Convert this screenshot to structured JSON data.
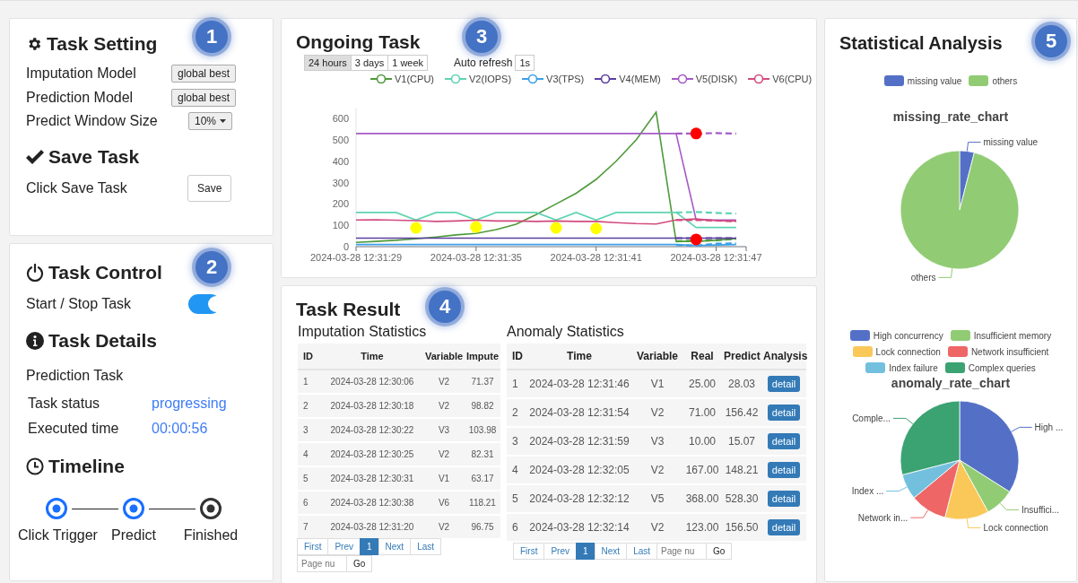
{
  "task_setting": {
    "badge": "1",
    "title": "Task Setting",
    "rows": [
      {
        "label": "Imputation Model",
        "control": "global best",
        "kind": "button"
      },
      {
        "label": "Prediction Model",
        "control": "global best",
        "kind": "button"
      },
      {
        "label": "Predict Window Size",
        "control": "10%",
        "kind": "dropdown"
      }
    ],
    "save_title": "Save Task",
    "save_label": "Click Save Task",
    "save_button": "Save"
  },
  "task_control": {
    "badge": "2",
    "title": "Task Control",
    "toggle_label": "Start / Stop Task",
    "toggle_on": true,
    "details_title": "Task Details",
    "details_subtitle": "Prediction Task",
    "details": [
      {
        "label": "Task status",
        "value": "progressing"
      },
      {
        "label": "Executed time",
        "value": "00:00:56"
      }
    ],
    "timeline_title": "Timeline",
    "timeline": [
      {
        "label": "Click Trigger",
        "done": true
      },
      {
        "label": "Predict",
        "done": true
      },
      {
        "label": "Finished",
        "done": false
      }
    ]
  },
  "ongoing_task": {
    "badge": "3",
    "title": "Ongoing Task",
    "ranges": [
      {
        "label": "24 hours",
        "selected": true
      },
      {
        "label": "3 days",
        "selected": false
      },
      {
        "label": "1 week",
        "selected": false
      }
    ],
    "auto_refresh_label": "Auto refresh",
    "auto_refresh_value": "1s",
    "chart_data": {
      "type": "line",
      "categories": [
        "2024-03-28 12:31:29",
        null,
        null,
        null,
        null,
        null,
        "2024-03-28 12:31:35",
        null,
        null,
        null,
        null,
        null,
        "2024-03-28 12:31:41",
        null,
        null,
        null,
        null,
        null,
        "2024-03-28 12:31:47",
        null
      ],
      "ylim": [
        0,
        650
      ],
      "yticks": [
        0,
        100,
        200,
        300,
        400,
        500,
        600
      ],
      "series": [
        {
          "name": "V1(CPU)",
          "color": "#4e9a3a",
          "values": [
            20,
            25,
            30,
            37,
            45,
            55,
            62,
            80,
            105,
            150,
            200,
            250,
            315,
            400,
            500,
            630,
            25,
            25,
            30,
            38
          ]
        },
        {
          "name": "V2(IOPS)",
          "color": "#5fd3b3",
          "values": [
            160,
            160,
            160,
            125,
            160,
            160,
            125,
            160,
            160,
            160,
            125,
            160,
            125,
            160,
            160,
            160,
            160,
            90,
            90,
            90
          ]
        },
        {
          "name": "V3(TPS)",
          "color": "#3ba0e8",
          "values": [
            10,
            10,
            10,
            10,
            10,
            10,
            10,
            10,
            10,
            10,
            10,
            10,
            10,
            10,
            10,
            10,
            10,
            5,
            8,
            10
          ]
        },
        {
          "name": "V4(MEM)",
          "color": "#5b3fa0",
          "values": [
            40,
            40,
            40,
            40,
            40,
            40,
            40,
            40,
            40,
            40,
            40,
            40,
            40,
            40,
            40,
            40,
            40,
            null,
            40,
            40
          ]
        },
        {
          "name": "V5(DISK)",
          "color": "#a65bc8",
          "values": [
            530,
            530,
            530,
            530,
            530,
            530,
            530,
            530,
            530,
            530,
            530,
            530,
            530,
            530,
            530,
            530,
            530,
            125,
            125,
            125
          ]
        },
        {
          "name": "V6(CPU)",
          "color": "#d14a7d",
          "values": [
            125,
            126,
            124,
            122,
            118,
            120,
            124,
            120,
            120,
            118,
            120,
            118,
            118,
            112,
            108,
            106,
            125,
            130,
            122,
            120
          ]
        },
        {
          "color": "#4e9a3a",
          "line_style": "dashed",
          "values": [
            null,
            null,
            null,
            null,
            null,
            null,
            null,
            null,
            null,
            null,
            null,
            null,
            null,
            null,
            null,
            null,
            25,
            28,
            30,
            36
          ]
        },
        {
          "color": "#5fd3b3",
          "line_style": "dashed",
          "values": [
            null,
            null,
            null,
            null,
            null,
            null,
            null,
            null,
            null,
            null,
            null,
            null,
            null,
            null,
            null,
            null,
            160,
            162,
            158,
            155
          ]
        },
        {
          "color": "#3ba0e8",
          "line_style": "dashed",
          "values": [
            null,
            null,
            null,
            null,
            null,
            null,
            null,
            null,
            null,
            null,
            null,
            null,
            null,
            null,
            null,
            null,
            8,
            5,
            14,
            15
          ]
        },
        {
          "color": "#5b3fa0",
          "line_style": "dashed",
          "values": [
            null,
            null,
            null,
            null,
            null,
            null,
            null,
            null,
            null,
            null,
            null,
            null,
            null,
            null,
            null,
            null,
            40,
            40,
            40,
            40
          ]
        },
        {
          "color": "#a65bc8",
          "line_style": "dashed",
          "values": [
            null,
            null,
            null,
            null,
            null,
            null,
            null,
            null,
            null,
            null,
            null,
            null,
            null,
            null,
            null,
            null,
            530,
            530,
            532,
            530
          ]
        },
        {
          "color": "#d14a7d",
          "line_style": "dashed",
          "values": [
            null,
            null,
            null,
            null,
            null,
            null,
            null,
            null,
            null,
            null,
            null,
            null,
            null,
            null,
            null,
            null,
            125,
            125,
            122,
            118
          ]
        },
        {
          "type": "scatter",
          "color": "#ffff00",
          "marker": "circle",
          "values": [
            null,
            null,
            null,
            88,
            null,
            null,
            92,
            null,
            null,
            null,
            88,
            null,
            85,
            null,
            null,
            null,
            null,
            null,
            null,
            null
          ]
        },
        {
          "type": "scatter",
          "color": "#ff0000",
          "marker": "circle",
          "values": [
            null,
            null,
            null,
            null,
            null,
            null,
            null,
            null,
            null,
            null,
            null,
            null,
            null,
            null,
            null,
            null,
            null,
            530,
            null,
            null
          ]
        },
        {
          "type": "scatter",
          "color": "#ff0000",
          "marker": "circle",
          "values": [
            null,
            null,
            null,
            null,
            null,
            null,
            null,
            null,
            null,
            null,
            null,
            null,
            null,
            null,
            null,
            null,
            null,
            34,
            null,
            null
          ]
        }
      ]
    }
  },
  "task_result": {
    "badge": "4",
    "title": "Task Result",
    "imputation": {
      "title": "Imputation Statistics",
      "columns": [
        "ID",
        "Time",
        "Variable",
        "Impute"
      ],
      "rows": [
        [
          "1",
          "2024-03-28 12:30:06",
          "V2",
          "71.37"
        ],
        [
          "2",
          "2024-03-28 12:30:18",
          "V2",
          "98.82"
        ],
        [
          "3",
          "2024-03-28 12:30:22",
          "V3",
          "103.98"
        ],
        [
          "4",
          "2024-03-28 12:30:25",
          "V2",
          "82.31"
        ],
        [
          "5",
          "2024-03-28 12:30:31",
          "V1",
          "63.17"
        ],
        [
          "6",
          "2024-03-28 12:30:38",
          "V6",
          "118.21"
        ],
        [
          "7",
          "2024-03-28 12:31:20",
          "V2",
          "96.75"
        ]
      ],
      "pager": [
        {
          "label": "First",
          "selected": false
        },
        {
          "label": "Prev",
          "selected": false
        },
        {
          "label": "1",
          "selected": true
        },
        {
          "label": "Next",
          "selected": false
        },
        {
          "label": "Last",
          "selected": false
        }
      ],
      "page_placeholder": "Page nu",
      "go": "Go"
    },
    "anomaly": {
      "title": "Anomaly Statistics",
      "columns": [
        "ID",
        "Time",
        "Variable",
        "Real",
        "Predict",
        "Analysis"
      ],
      "rows": [
        {
          "cells": [
            "1",
            "2024-03-28 12:31:46",
            "V1",
            "25.00",
            "28.03"
          ],
          "action": "detail"
        },
        {
          "cells": [
            "2",
            "2024-03-28 12:31:54",
            "V2",
            "71.00",
            "156.42"
          ],
          "action": "detail"
        },
        {
          "cells": [
            "3",
            "2024-03-28 12:31:59",
            "V3",
            "10.00",
            "15.07"
          ],
          "action": "detail"
        },
        {
          "cells": [
            "4",
            "2024-03-28 12:32:05",
            "V2",
            "167.00",
            "148.21"
          ],
          "action": "detail"
        },
        {
          "cells": [
            "5",
            "2024-03-28 12:32:12",
            "V5",
            "368.00",
            "528.30"
          ],
          "action": "detail"
        },
        {
          "cells": [
            "6",
            "2024-03-28 12:32:14",
            "V2",
            "123.00",
            "156.50"
          ],
          "action": "detail"
        }
      ],
      "pager": [
        {
          "label": "First",
          "selected": false
        },
        {
          "label": "Prev",
          "selected": false
        },
        {
          "label": "1",
          "selected": true
        },
        {
          "label": "Next",
          "selected": false
        },
        {
          "label": "Last",
          "selected": false
        }
      ],
      "page_placeholder": "Page nu",
      "go": "Go"
    }
  },
  "statistical_analysis": {
    "badge": "5",
    "title": "Statistical Analysis",
    "charts": [
      {
        "chart_data": {
          "type": "pie",
          "title": "missing_rate_chart",
          "categories": [
            "missing value",
            "others"
          ],
          "values": [
            4,
            96
          ],
          "colors": [
            "#5470c6",
            "#91cc75"
          ],
          "value_labels": [
            "missing value",
            "others"
          ]
        }
      },
      {
        "chart_data": {
          "type": "pie",
          "title": "anomaly_rate_chart",
          "categories": [
            "High concurrency",
            "Insufficient memory",
            "Lock connection",
            "Network insufficient",
            "Index failure",
            "Complex queries"
          ],
          "values": [
            34,
            8,
            12,
            10,
            7,
            29
          ],
          "colors": [
            "#5470c6",
            "#91cc75",
            "#fac858",
            "#ee6666",
            "#73c0de",
            "#3ba272"
          ],
          "value_labels": [
            "High ...",
            "Insuffici...",
            "Lock connection",
            "Network in...",
            "Index ...",
            "Comple..."
          ]
        }
      }
    ]
  }
}
